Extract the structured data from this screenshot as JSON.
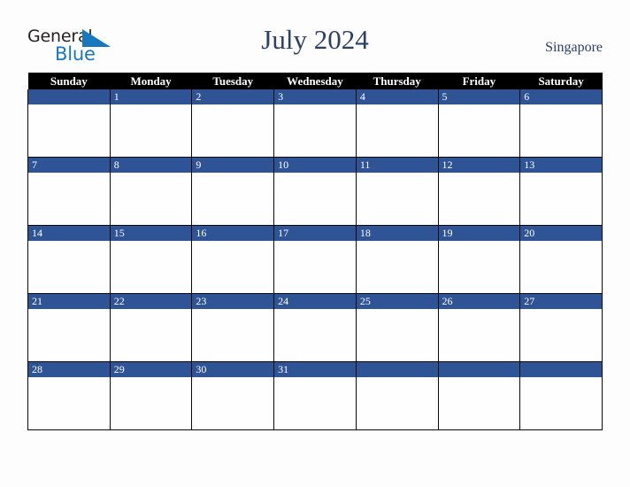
{
  "logo": {
    "word_one": "General",
    "word_two": "Blue",
    "triangle_icon": "blue-triangle-icon",
    "text_color": "#231f20",
    "blue_color": "#1878be"
  },
  "header": {
    "title": "July 2024",
    "country": "Singapore",
    "title_color": "#2c3f66"
  },
  "calendar": {
    "weekday_headers": [
      "Sunday",
      "Monday",
      "Tuesday",
      "Wednesday",
      "Thursday",
      "Friday",
      "Saturday"
    ],
    "header_bg": "#000000",
    "header_text_color": "#ffffff",
    "date_bar_bg": "#2f5496",
    "date_text_color": "#ffffff",
    "cell_bg": "#ffffff",
    "border_color": "#0a0a0a",
    "weeks": [
      [
        "",
        "1",
        "2",
        "3",
        "4",
        "5",
        "6"
      ],
      [
        "7",
        "8",
        "9",
        "10",
        "11",
        "12",
        "13"
      ],
      [
        "14",
        "15",
        "16",
        "17",
        "18",
        "19",
        "20"
      ],
      [
        "21",
        "22",
        "23",
        "24",
        "25",
        "26",
        "27"
      ],
      [
        "28",
        "29",
        "30",
        "31",
        "",
        "",
        ""
      ]
    ]
  },
  "page": {
    "background": "#fdfdfd"
  }
}
